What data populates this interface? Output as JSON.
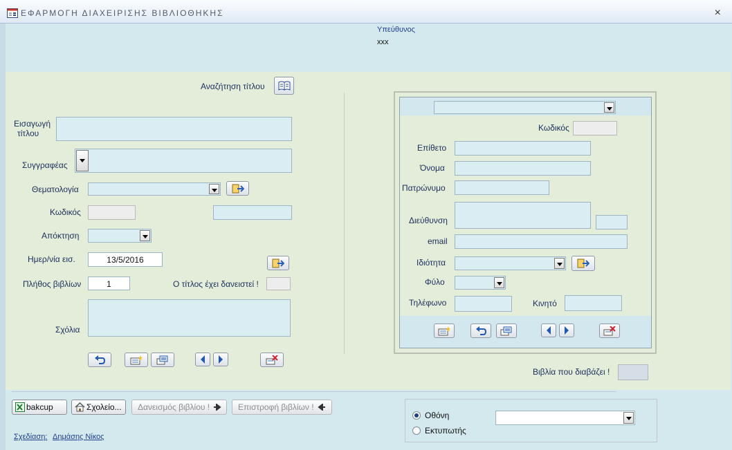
{
  "window": {
    "title": "ΕΦΑΡΜΟΓΗ ΔΙΑΧΕΙΡΙΣΗΣ ΒΙΒΛΙΟΘΗΚΗΣ",
    "close_glyph": "×"
  },
  "header": {
    "responsible_label": "Υπεύθυνος",
    "responsible_value": "xxx"
  },
  "book_form": {
    "search_title_label": "Αναζήτηση τίτλου",
    "title_label_line1": "Εισαγωγή",
    "title_label_line2": "τίτλου",
    "title_value": "",
    "author_label": "Συγγραφέας",
    "author_value": "",
    "subject_label": "Θεματολογία",
    "subject_value": "",
    "code_label": "Κωδικός",
    "code_value": "",
    "code_extra_value": "",
    "acquisition_label": "Απόκτηση",
    "acquisition_value": "",
    "entry_date_label": "Ημερ/νία εισ.",
    "entry_date_value": "13/5/2016",
    "count_label": "Πλήθος βιβλίων",
    "count_value": "1",
    "borrowed_label": "Ο τίτλος έχει δανειστεί !",
    "comments_label": "Σχόλια",
    "comments_value": ""
  },
  "member_form": {
    "selector_value": "",
    "code_label": "Κωδικός",
    "surname_label": "Επίθετο",
    "name_label": "Όνομα",
    "father_label": "Πατρώνυμο",
    "address_label": "Διεύθυνση",
    "email_label": "email",
    "status_label": "Ιδιότητα",
    "gender_label": "Φύλο",
    "phone_label": "Τηλέφωνο",
    "mobile_label": "Κινητό",
    "reading_label": "Βιβλία που διαβάζει !"
  },
  "footer": {
    "backup_label": "bakcup",
    "school_label": "Σχολείο...",
    "lend_label": "Δανεισμός βιβλίου !",
    "return_label": "Επιστροφή βιβλίων !",
    "designer_label": "Σχεδίαση:",
    "designer_name": "Δημάσης Νίκος",
    "output_screen_label": "Οθόνη",
    "output_printer_label": "Εκτυπωτής",
    "output_selected": "Οθόνη",
    "report_value": ""
  },
  "colors": {
    "header_band": "#d3e9ee",
    "detail_band": "#e4ecda",
    "field_fill": "#d9edf3",
    "label_text": "#1a2f5a",
    "accent_link": "#1e3f8a"
  },
  "icons": [
    "form-app-icon",
    "book-search-icon",
    "add-record-icon",
    "undo-icon",
    "new-record-icon",
    "save-icon",
    "prev-icon",
    "next-icon",
    "delete-icon",
    "excel-icon",
    "home-icon",
    "arrow-right-icon",
    "arrow-left-icon"
  ]
}
